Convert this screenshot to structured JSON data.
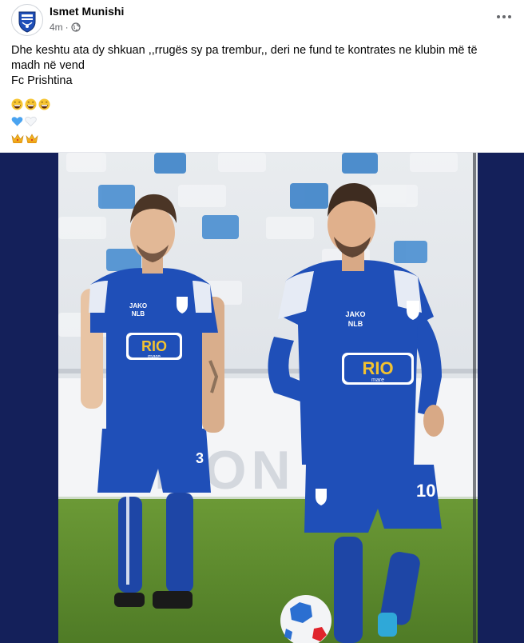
{
  "post": {
    "author": "Ismet Munishi",
    "time": "4m",
    "separator": "·",
    "text_lines": [
      "Dhe keshtu ata dy shkuan ,,rrugës sy pa trembur,,   deri ne fund te kontrates ne klubin më të",
      "madh në vend",
      "Fc Prishtina"
    ]
  },
  "photo": {
    "sponsor_top": "JAKO",
    "sponsor_mid": "NLB",
    "sponsor_main": "RIO",
    "sponsor_sub": "mare",
    "number_left": "3",
    "number_right": "10",
    "board_text": "MON"
  },
  "colors": {
    "kit_blue": "#1f4fb8",
    "border_navy": "#14205a",
    "pitch_green": "#5d8a2f",
    "muted_text": "#65676b"
  },
  "icons": {
    "avatar": "club-crest-icon",
    "privacy": "globe-icon",
    "more": "more-options-icon"
  }
}
